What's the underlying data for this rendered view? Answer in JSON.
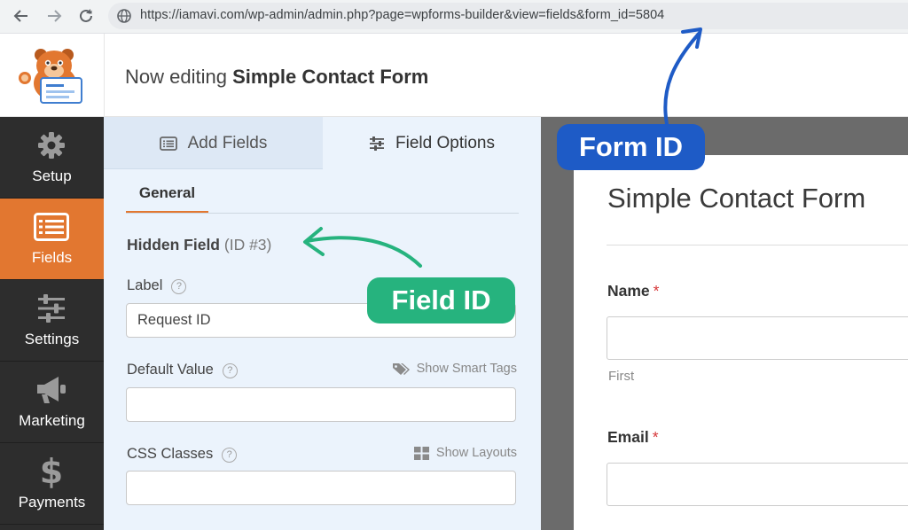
{
  "browser": {
    "url": "https://iamavi.com/wp-admin/admin.php?page=wpforms-builder&view=fields&form_id=5804",
    "back_icon": "arrow-left-icon",
    "forward_icon": "arrow-right-icon",
    "reload_icon": "reload-icon",
    "site_icon": "globe-icon"
  },
  "header": {
    "prefix": "Now editing",
    "form_name": "Simple Contact Form",
    "logo_icon": "wpforms-bear-logo"
  },
  "sidebar": {
    "items": [
      {
        "label": "Setup",
        "icon": "gear-icon"
      },
      {
        "label": "Fields",
        "icon": "list-icon",
        "active": true
      },
      {
        "label": "Settings",
        "icon": "sliders-icon"
      },
      {
        "label": "Marketing",
        "icon": "megaphone-icon"
      },
      {
        "label": "Payments",
        "icon": "dollar-icon"
      }
    ]
  },
  "panel": {
    "tabs": [
      {
        "label": "Add Fields",
        "icon": "list-icon"
      },
      {
        "label": "Field Options",
        "icon": "sliders-icon"
      }
    ],
    "subtab": "General",
    "field_type": "Hidden Field",
    "field_id": "(ID #3)",
    "label_label": "Label",
    "label_value": "Request ID",
    "default_value_label": "Default Value",
    "default_value": "",
    "smart_tags": "Show Smart Tags",
    "css_classes_label": "CSS Classes",
    "css_classes_value": "",
    "show_layouts": "Show Layouts",
    "help_glyph": "?"
  },
  "preview": {
    "title": "Simple Contact Form",
    "fields": [
      {
        "label": "Name",
        "required": "*",
        "sublabel": "First"
      },
      {
        "label": "Email",
        "required": "*"
      }
    ]
  },
  "annotations": {
    "form_id": "Form ID",
    "field_id": "Field ID",
    "form_id_color": "#1e5bc6",
    "field_id_color": "#26b37e"
  },
  "colors": {
    "accent": "#e27730",
    "sidebar_bg": "#2d2d2d",
    "panel_bg": "#ebf3fc"
  }
}
